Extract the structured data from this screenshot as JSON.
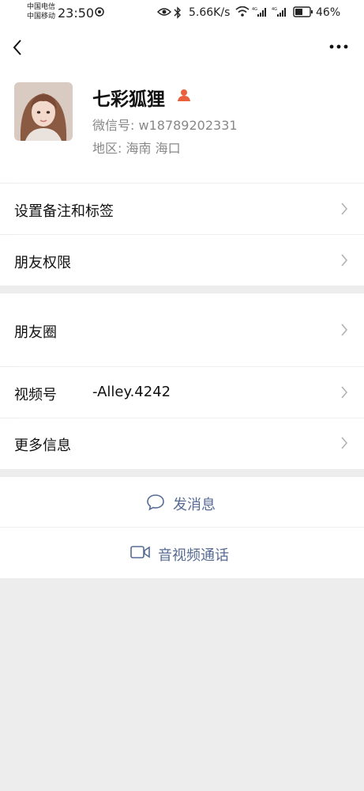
{
  "status_bar": {
    "carrier1": "中国电信",
    "carrier2": "中国移动",
    "time": "23:50",
    "net_speed": "5.66K/s",
    "battery": "46%"
  },
  "nav": {
    "back_icon": "chevron-left-icon",
    "more_icon": "more-dots-icon"
  },
  "profile": {
    "nickname": "七彩狐狸",
    "wxid_label": "微信号:",
    "wxid_value": "w18789202331",
    "region_label": "地区:",
    "region_value": "海南  海口"
  },
  "menu": {
    "remark": "设置备注和标签",
    "permissions": "朋友权限",
    "moments": "朋友圈",
    "channels_label": "视频号",
    "channels_value": "-Alley.4242",
    "more_info": "更多信息"
  },
  "actions": {
    "message": "发消息",
    "call": "音视频通话"
  },
  "colors": {
    "accent": "#576b95",
    "background": "#ededed",
    "badge": "#e8613c"
  }
}
